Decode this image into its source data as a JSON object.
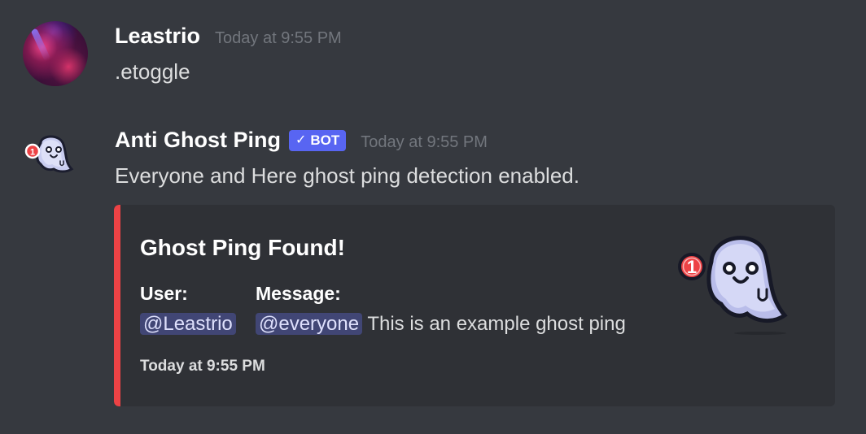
{
  "messages": [
    {
      "username": "Leastrio",
      "timestamp": "Today at 9:55 PM",
      "content": ".etoggle",
      "avatar": "user-avatar-image"
    },
    {
      "username": "Anti Ghost Ping",
      "bot_tag": "BOT",
      "bot_check_icon": "✓",
      "timestamp": "Today at 9:55 PM",
      "content": "Everyone and Here ghost ping detection enabled.",
      "avatar": "ghost-icon",
      "avatar_badge": "1",
      "embed": {
        "accent_color": "#ed4245",
        "title": "Ghost Ping Found!",
        "fields": [
          {
            "name": "User:",
            "mention": "@Leastrio",
            "text": ""
          },
          {
            "name": "Message:",
            "mention": "@everyone",
            "text": "This is an example ghost ping"
          }
        ],
        "footer": "Today at 9:55 PM",
        "thumbnail": "ghost-icon",
        "thumbnail_badge": "1"
      }
    }
  ],
  "colors": {
    "background": "#36393f",
    "embed_background": "#2f3136",
    "bot_tag": "#5865f2",
    "mention_background": "#414675",
    "mention_text": "#dee0fc",
    "timestamp": "#72767d",
    "badge": "#ed4245"
  }
}
